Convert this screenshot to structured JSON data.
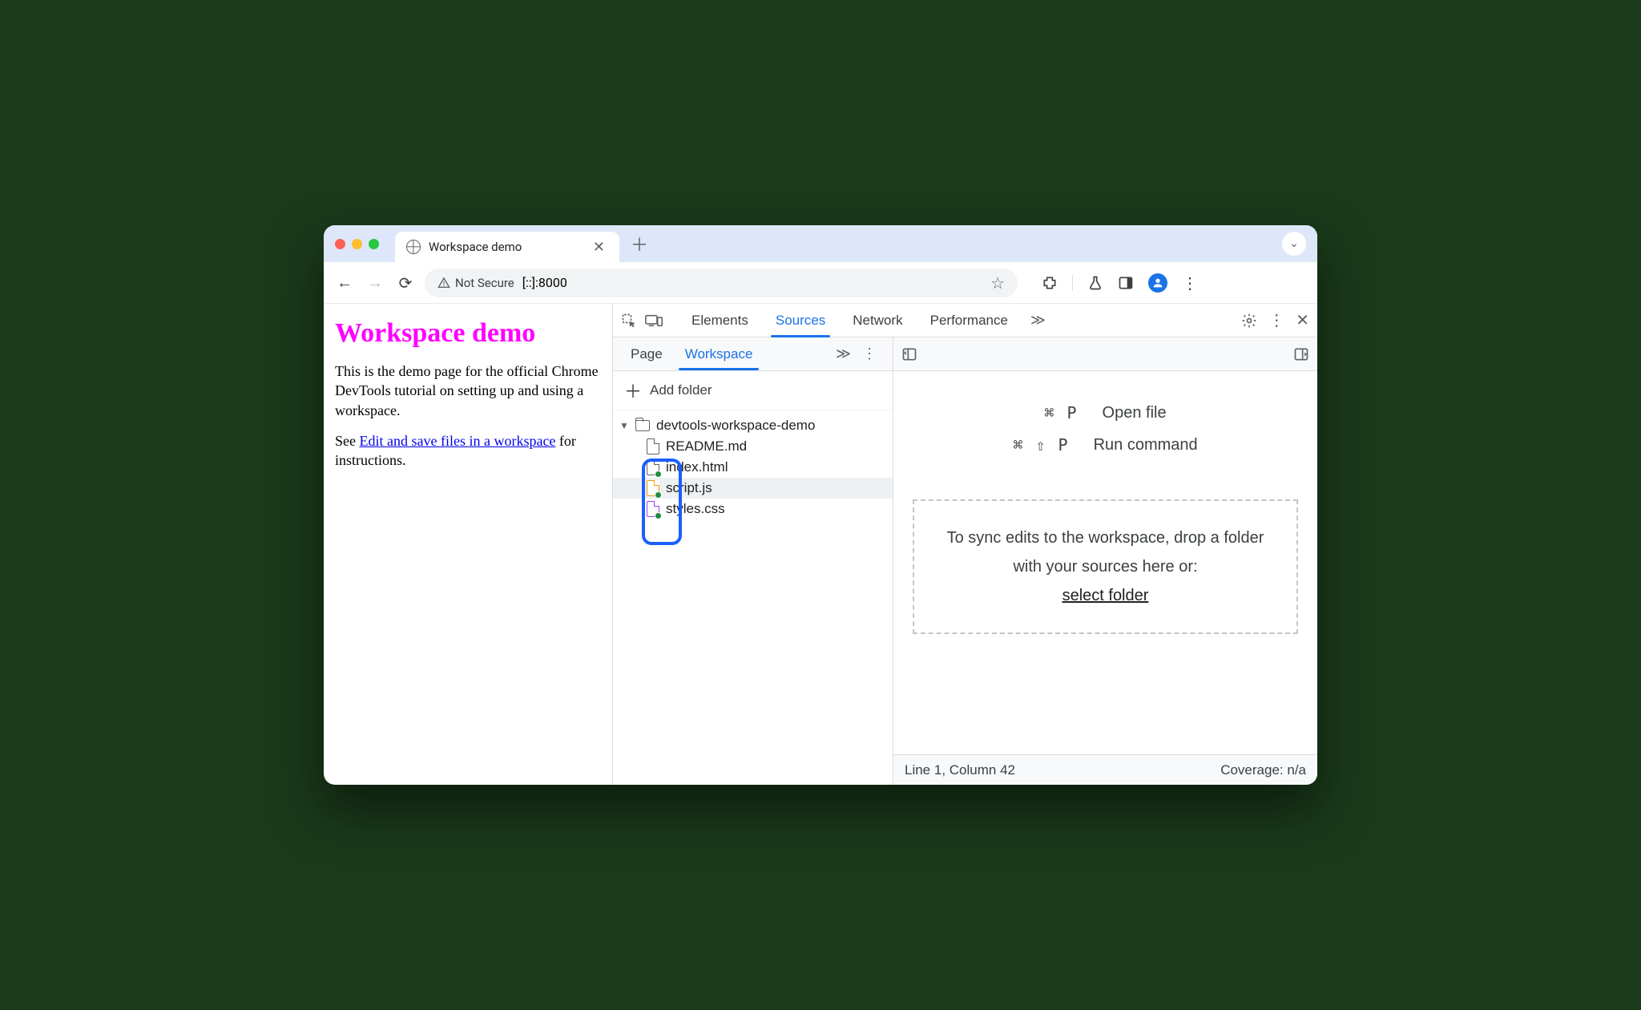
{
  "browser": {
    "tab_title": "Workspace demo",
    "not_secure": "Not Secure",
    "url": "[::]:8000"
  },
  "page": {
    "heading": "Workspace demo",
    "para1": "This is the demo page for the official Chrome DevTools tutorial on setting up and using a workspace.",
    "para2_before": "See ",
    "para2_link": "Edit and save files in a workspace",
    "para2_after": " for instructions."
  },
  "devtools": {
    "tabs": {
      "elements": "Elements",
      "sources": "Sources",
      "network": "Network",
      "performance": "Performance"
    },
    "sub": {
      "page": "Page",
      "workspace": "Workspace"
    },
    "add_folder": "Add folder",
    "root": "devtools-workspace-demo",
    "files": [
      "README.md",
      "index.html",
      "script.js",
      "styles.css"
    ],
    "shortcuts": {
      "open_keys": "⌘ P",
      "open_label": "Open file",
      "run_keys": "⌘ ⇧ P",
      "run_label": "Run command"
    },
    "dropzone": {
      "line": "To sync edits to the workspace, drop a folder with your sources here or:",
      "link": "select folder"
    },
    "status_left": "Line 1, Column 42",
    "status_right": "Coverage: n/a"
  }
}
